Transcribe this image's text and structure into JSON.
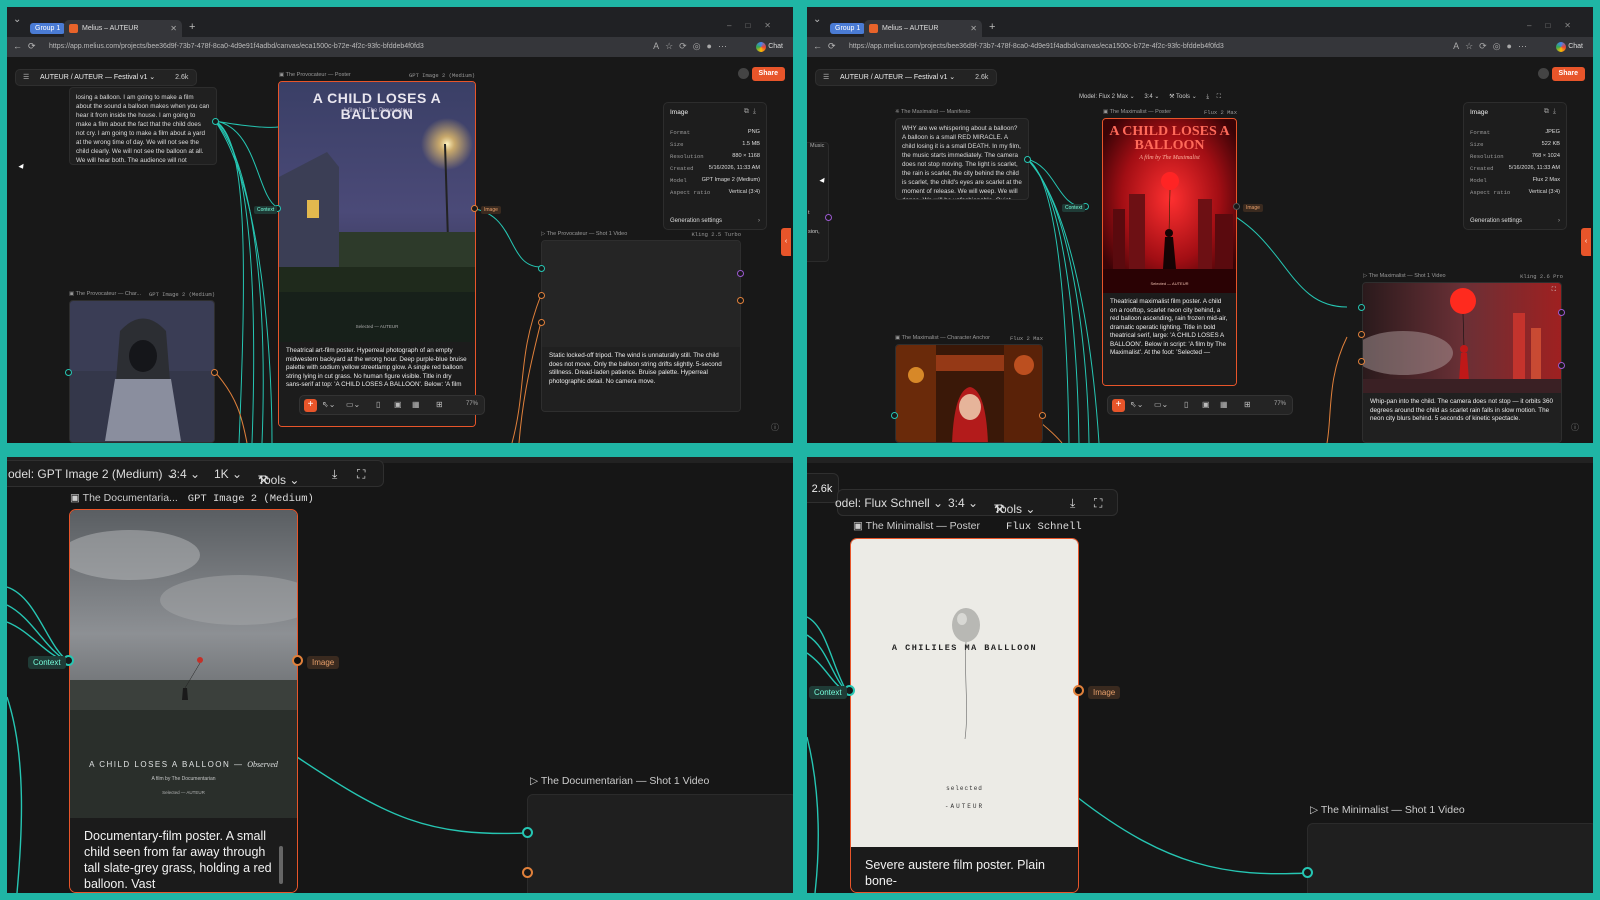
{
  "browser": {
    "group_label": "Group 1",
    "tab_title": "Melius – AUTEUR",
    "url_p1": "https://app.melius.com/projects/bee36d9f-73b7-478f-8ca0-4d9e91f4adbd/canvas/eca1500c-b72e-4f2c-93fc-bfddeb4f0fd3",
    "url_p2": "https://app.melius.com/projects/bee36d9f-73b7-478f-8ca0-4d9e91f4adbd/canvas/eca1500c-b72e-4f2c-93fc-bfddeb4f0fd3",
    "chat_label": "Chat"
  },
  "project": {
    "breadcrumb": "AUTEUR /  AUTEUR — Festival v1 ⌄",
    "credits": "2.6k",
    "share_label": "Share"
  },
  "panel1": {
    "manifesto_text": "losing a balloon. I am going to make a film about the sound a balloon makes when you can hear it from inside the house. I am going to make a film about the fact that the child does not cry. I am going to make a film about a yard at the wrong time of day. We will not see the child clearly. We will not see the balloon at all. We will hear both. The audience will not",
    "poster_label": "The Provocateur — Poster",
    "poster_model": "GPT Image 2 (Medium)",
    "poster_title": "A CHILD LOSES A BALLOON",
    "poster_subtitle": "A film by The Provocateur",
    "poster_footer": "Selected — AUTEUR",
    "poster_caption": "Theatrical art-film poster. Hyperreal photograph of an empty midwestern backyard at the wrong hour. Deep purple-blue bruise palette with sodium yellow streetlamp glow. A single red balloon string lying in cut grass. No human figure visible. Title in dry sans-serif at top: 'A CHILD LOSES A BALLOON'. Below: 'A film",
    "char_label": "The Provocateur — Char...",
    "char_model": "GPT Image 2 (Medium)",
    "video_label": "The Provocateur — Shot 1 Video",
    "video_model": "Kling 2.5 Turbo",
    "video_caption": "Static locked-off tripod. The wind is unnaturally still. The child does not move. Only the balloon string drifts slightly. 5-second stillness. Dread-laden patience. Bruise palette. Hyperreal photographic detail. No camera move.",
    "zoom": "77%",
    "context_tag": "Context",
    "image_tag": "Image",
    "info": {
      "title": "Image",
      "rows": [
        {
          "k": "Format",
          "v": "PNG"
        },
        {
          "k": "Size",
          "v": "1.5 MB"
        },
        {
          "k": "Resolution",
          "v": "880 × 1168"
        },
        {
          "k": "Created",
          "v": "5/16/2026, 11:33 AM"
        },
        {
          "k": "Model",
          "v": "GPT Image 2 (Medium)"
        },
        {
          "k": "Aspect ratio",
          "v": "Vertical (3:4)"
        }
      ],
      "gen_settings": "Generation settings"
    }
  },
  "panel2": {
    "toolbar": {
      "model": "Model: Flux 2 Max ⌄",
      "ratio": "3:4 ⌄",
      "tools": "Tools ⌄"
    },
    "side_label": "Music",
    "side_frag1": "t",
    "side_frag2": "sion,",
    "manifesto_label": "The Maximalist — Manifesto",
    "manifesto_text": "WHY are we whispering about a balloon? A balloon is a small RED MIRACLE. A child losing it is a small DEATH. In my film, the music starts immediately. The camera does not stop moving. The light is scarlet, the rain is scarlet, the city behind the child is scarlet, the child's eyes are scarlet at the moment of release. We will weep. We will dance. We will be unfashionable. Quiet cinema has had its",
    "poster_label": "The Maximalist — Poster",
    "poster_model": "Flux 2 Max",
    "poster_title": "A CHILD LOSES A BALLOON",
    "poster_subtitle": "A film by The Maximalist",
    "poster_footer": "Selected — AUTEUR",
    "poster_caption": "Theatrical maximalist film poster. A child on a rooftop, scarlet neon city behind, a red balloon ascending, rain frozen mid-air, dramatic operatic lighting. Title in bold theatrical serif, large: 'A CHILD LOSES A BALLOON'. Below in script: 'A film by The Maximalist'. At the foot: 'Selected —",
    "char_label": "The Maximalist — Character Anchor",
    "char_model": "Flux 2 Max",
    "video_label": "The Maximalist — Shot 1 Video",
    "video_model": "Kling 2.6 Pro",
    "video_caption": "Whip-pan into the child. The camera does not stop — it orbits 360 degrees around the child as scarlet rain falls in slow motion. The neon city blurs behind. 5 seconds of kinetic spectacle.",
    "zoom": "77%",
    "info": {
      "title": "Image",
      "rows": [
        {
          "k": "Format",
          "v": "JPEG"
        },
        {
          "k": "Size",
          "v": "522 KB"
        },
        {
          "k": "Resolution",
          "v": "768 × 1024"
        },
        {
          "k": "Created",
          "v": "5/16/2026, 11:33 AM"
        },
        {
          "k": "Model",
          "v": "Flux 2 Max"
        },
        {
          "k": "Aspect ratio",
          "v": "Vertical (3:4)"
        }
      ],
      "gen_settings": "Generation settings"
    }
  },
  "panel3": {
    "toolbar": {
      "model": "odel: GPT Image 2 (Medium) ⌄",
      "ratio": "3:4 ⌄",
      "res": "1K ⌄",
      "tools": "Tools ⌄"
    },
    "poster_label": "The Documentaria...",
    "poster_model": "GPT Image 2 (Medium)",
    "poster_title": "A CHILD LOSES A BALLOON —",
    "poster_title_italic": "Observed",
    "poster_subtitle": "A film by The Documentarian",
    "poster_footer": "Selected — AUTEUR",
    "poster_caption": "Documentary-film poster. A small child seen from far away through tall slate-grey grass, holding a red balloon. Vast",
    "context_tag": "Context",
    "image_tag": "Image",
    "video_label": "The Documentarian — Shot 1 Video"
  },
  "panel4": {
    "credits": "2.6k",
    "toolbar": {
      "model": "odel: Flux Schnell ⌄",
      "ratio": "3:4 ⌄",
      "tools": "Tools ⌄"
    },
    "poster_label": "The Minimalist — Poster",
    "poster_model": "Flux Schnell",
    "poster_title": "A CHILILES MA BALLLOON",
    "poster_footer1": "selected",
    "poster_footer2": "-AUTEUR",
    "poster_caption": "Severe austere film poster. Plain bone-",
    "context_tag": "Context",
    "image_tag": "Image",
    "video_label": "The Minimalist — Shot 1 Video"
  },
  "colors": {
    "accent": "#e8552a",
    "wire": "#26c6b3",
    "border": "#1fb5a5"
  }
}
